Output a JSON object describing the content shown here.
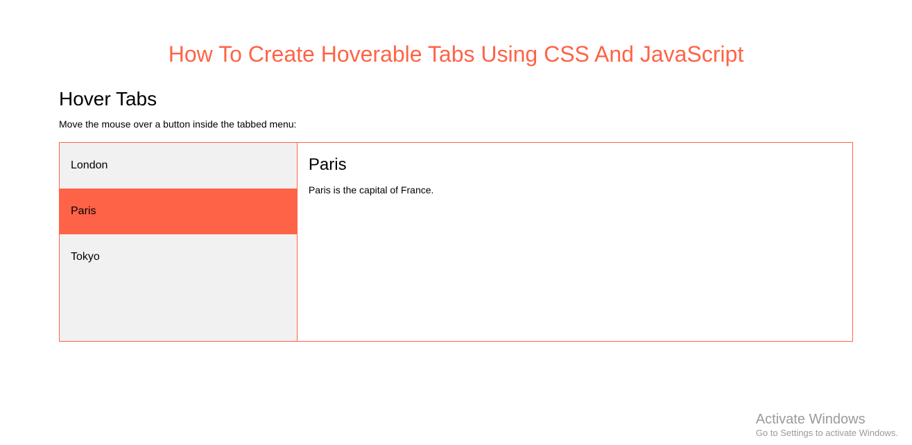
{
  "header": {
    "main_title": "How To Create Hoverable Tabs Using CSS And JavaScript",
    "sub_title": "Hover Tabs",
    "instruction": "Move the mouse over a button inside the tabbed menu:"
  },
  "tabs": {
    "items": [
      {
        "label": "London",
        "active": false
      },
      {
        "label": "Paris",
        "active": true
      },
      {
        "label": "Tokyo",
        "active": false
      }
    ]
  },
  "content": {
    "title": "Paris",
    "text": "Paris is the capital of France."
  },
  "watermark": {
    "line1": "Activate Windows",
    "line2": "Go to Settings to activate Windows."
  }
}
